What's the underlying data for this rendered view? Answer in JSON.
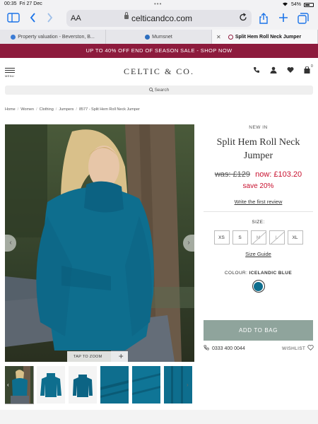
{
  "status_bar": {
    "time": "00:35",
    "date": "Fri 27 Dec",
    "battery": "54%"
  },
  "browser": {
    "text_size_label": "AA",
    "url": "celticandco.com",
    "tabs": [
      {
        "label": "Property valuation - Beverston, B..."
      },
      {
        "label": "Mumsnet"
      },
      {
        "label": "Split Hem Roll Neck Jumper"
      }
    ]
  },
  "promo": {
    "text": "UP TO 40% OFF END OF SEASON SALE - SHOP NOW"
  },
  "header": {
    "menu_label": "MENU",
    "logo": "CELTIC & CO.",
    "bag_count": "0"
  },
  "search": {
    "placeholder": "Search"
  },
  "breadcrumb": [
    "Home",
    "Women",
    "Clothing",
    "Jumpers",
    "8577 - Split Hem Roll Neck Jumper"
  ],
  "gallery": {
    "zoom_label": "TAP TO ZOOM"
  },
  "product": {
    "badge": "NEW IN",
    "title": "Split Hem Roll Neck Jumper",
    "was_price": "was: £129",
    "now_price": "now: £103.20",
    "save": "save 20%",
    "review_link": "Write the first review",
    "size_label": "SIZE:",
    "sizes": [
      {
        "label": "XS",
        "available": true
      },
      {
        "label": "S",
        "available": true
      },
      {
        "label": "M",
        "available": false
      },
      {
        "label": "L",
        "available": false
      },
      {
        "label": "XL",
        "available": true
      }
    ],
    "size_guide": "Size Guide",
    "colour_label": "COLOUR:",
    "colour_name": "ICELANDIC BLUE",
    "colour_hex": "#0e6e8e",
    "add_to_bag": "ADD TO BAG",
    "phone": "0333 400 0044",
    "wishlist": "WISHLIST"
  },
  "colors": {
    "promo_bg": "#8d1b3d",
    "sale_red": "#c8102e",
    "button_bg": "#8fa49c",
    "ios_blue": "#1a73e8"
  }
}
